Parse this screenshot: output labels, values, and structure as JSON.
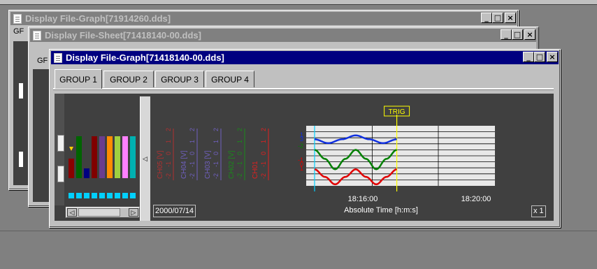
{
  "windows": {
    "back": {
      "title": "Display File-Graph[71914260.dds]",
      "tab_fragment": "GF"
    },
    "middle": {
      "title": "Display File-Sheet[71418140-00.dds]",
      "tab_fragment": "GF"
    },
    "front": {
      "title": "Display File-Graph[71418140-00.dds]"
    }
  },
  "window_buttons": {
    "minimize": "_",
    "maximize": "□",
    "close": "×"
  },
  "tabs": [
    {
      "label": "GROUP 1",
      "selected": true
    },
    {
      "label": "GROUP 2",
      "selected": false
    },
    {
      "label": "GROUP 3",
      "selected": false
    },
    {
      "label": "GROUP 4",
      "selected": false
    }
  ],
  "bar_meter": {
    "bars": [
      {
        "color": "#8b0000",
        "level": 0.4
      },
      {
        "color": "#006400",
        "level": 0.85
      },
      {
        "color": "#000080",
        "level": 0.2
      },
      {
        "color": "#800000",
        "level": 0.85
      },
      {
        "color": "#6a3d8f",
        "level": 0.85
      },
      {
        "color": "#ff8c00",
        "level": 0.85
      },
      {
        "color": "#a0d040",
        "level": 0.85
      },
      {
        "color": "#ff80ff",
        "level": 0.85
      },
      {
        "color": "#00b0b0",
        "level": 0.85
      }
    ]
  },
  "channels": [
    {
      "name": "CH05 [V]",
      "color": "#b03030",
      "ticks": [
        "-2",
        "-1",
        "0",
        "1",
        "2"
      ]
    },
    {
      "name": "CH04 [V]",
      "color": "#7060c0",
      "ticks": [
        "-2",
        "-1",
        "0",
        "1",
        "2"
      ]
    },
    {
      "name": "CH03 [V]",
      "color": "#7060c0",
      "ticks": [
        "-2",
        "-1",
        "0",
        "1",
        "2"
      ]
    },
    {
      "name": "CH02 [V]",
      "color": "#1a8a1a",
      "ticks": [
        "-2",
        "-1",
        "0",
        "1",
        "2"
      ]
    },
    {
      "name": "CH01",
      "color": "#e02020",
      "ticks": [
        "-2",
        "-1",
        "0",
        "1",
        "2"
      ]
    }
  ],
  "chart_data": {
    "type": "line",
    "x_ticks": [
      "18:16:00",
      "18:20:00"
    ],
    "xlabel": "Absolute Time [h:m:s]",
    "date": "2000/07/14",
    "trigger_label": "TRIG",
    "scale_label": "x 1",
    "left_scale_labels": {
      "blue": [
        "1",
        "3"
      ],
      "green": [
        "-2"
      ],
      "red": [
        "-1",
        "0",
        "1"
      ]
    },
    "series": [
      {
        "color": "#1030e0",
        "values": [
          0.55,
          0.42,
          0.55,
          0.68,
          0.55,
          0.42,
          0.55
        ]
      },
      {
        "color": "#008000",
        "values": [
          0.2,
          -0.1,
          -0.45,
          -0.1,
          0.2,
          -0.1,
          -0.45,
          -0.1,
          0.2
        ]
      },
      {
        "color": "#e00000",
        "values": [
          -0.45,
          -0.7,
          -0.95,
          -0.7,
          -0.45,
          -0.7,
          -0.95,
          -0.7,
          -0.45
        ]
      }
    ]
  }
}
